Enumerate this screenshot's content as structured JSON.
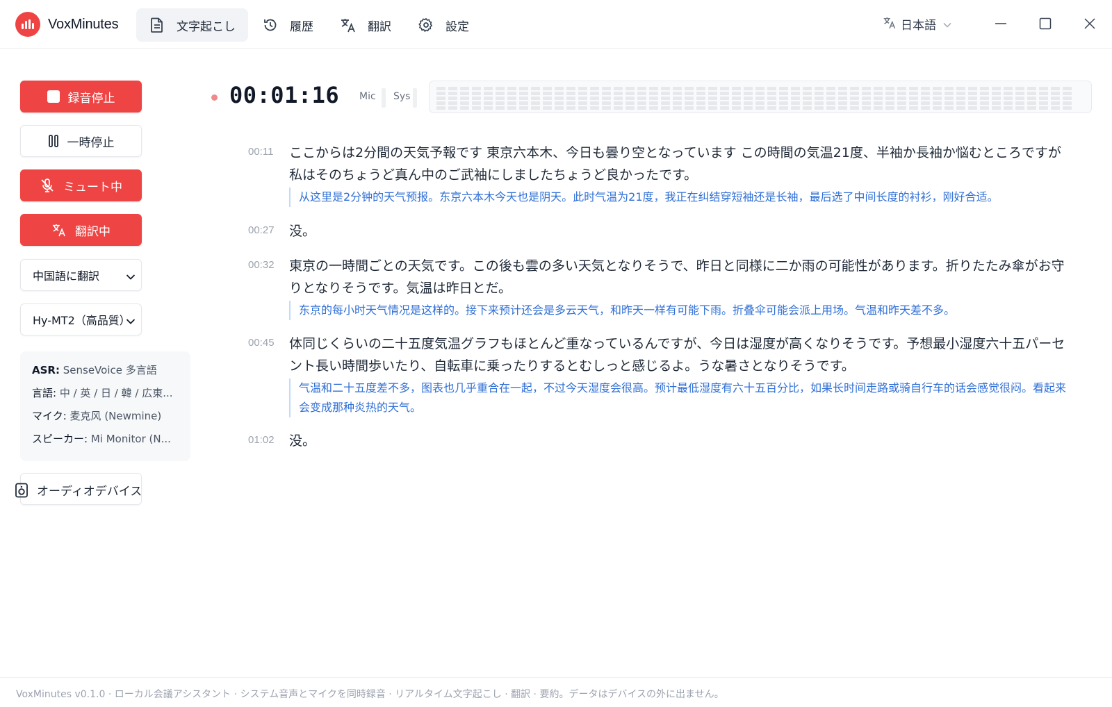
{
  "app": {
    "name": "VoxMinutes"
  },
  "nav": [
    {
      "label": "文字起こし",
      "icon": "document-icon",
      "active": true
    },
    {
      "label": "履歴",
      "icon": "history-icon",
      "active": false
    },
    {
      "label": "翻訳",
      "icon": "translate-icon",
      "active": false
    },
    {
      "label": "設定",
      "icon": "gear-icon",
      "active": false
    }
  ],
  "language": {
    "label": "日本語",
    "icon": "translate-icon"
  },
  "sidebar": {
    "stop_label": "録音停止",
    "pause_label": "一時停止",
    "mute_label": "ミュート中",
    "translate_label": "翻訳中",
    "target_select": "中国語に翻訳",
    "model_select": "Hy-MT2（高品質）",
    "info": {
      "asr_key": "ASR:",
      "asr_val": "SenseVoice 多言語",
      "lang_key": "言語:",
      "lang_val": "中 / 英 / 日 / 韓 / 広東...",
      "mic_key": "マイク:",
      "mic_val": "麦克风 (Newmine)",
      "spk_key": "スピーカー:",
      "spk_val": "Mi Monitor (N..."
    },
    "audio_devices_label": "オーディオデバイス"
  },
  "recorder": {
    "timer": "00:01:16",
    "mic_label": "Mic",
    "sys_label": "Sys"
  },
  "segments": [
    {
      "time": "00:11",
      "text": "ここからは2分間の天気予報です 東京六本木、今日も曇り空となっています この時間の気温21度、半袖か長袖か悩むところですが 私はそのちょうど真ん中のご武袖にしましたちょうど良かったです。",
      "translation": "从这里是2分钟的天气预报。东京六本木今天也是阴天。此时气温为21度，我正在纠结穿短袖还是长袖，最后选了中间长度的衬衫，刚好合适。"
    },
    {
      "time": "00:27",
      "text": "没。",
      "translation": ""
    },
    {
      "time": "00:32",
      "text": "東京の一時間ごとの天気です。この後も雲の多い天気となりそうで、昨日と同様に二か雨の可能性があります。折りたたみ傘がお守りとなりそうです。気温は昨日とだ。",
      "translation": "东京的每小时天气情况是这样的。接下来预计还会是多云天气，和昨天一样有可能下雨。折叠伞可能会派上用场。气温和昨天差不多。"
    },
    {
      "time": "00:45",
      "text": "体同じくらいの二十五度気温グラフもほとんど重なっているんですが、今日は湿度が高くなりそうです。予想最小湿度六十五パーセント長い時間歩いたり、自転車に乗ったりするとむしっと感じるよ。うな暑さとなりそうです。",
      "translation": "气温和二十五度差不多，图表也几乎重合在一起，不过今天湿度会很高。预计最低湿度有六十五百分比，如果长时间走路或骑自行车的话会感觉很闷。看起来会变成那种炎热的天气。"
    },
    {
      "time": "01:02",
      "text": "没。",
      "translation": ""
    }
  ],
  "footer": "VoxMinutes v0.1.0 · ローカル会議アシスタント · システム音声とマイクを同時録音 · リアルタイム文字起こし · 翻訳 · 要約。データはデバイスの外に出ません。",
  "colors": {
    "accent": "#ef4444",
    "translation": "#2f6fd6",
    "translation_border": "#bfdbfe"
  }
}
